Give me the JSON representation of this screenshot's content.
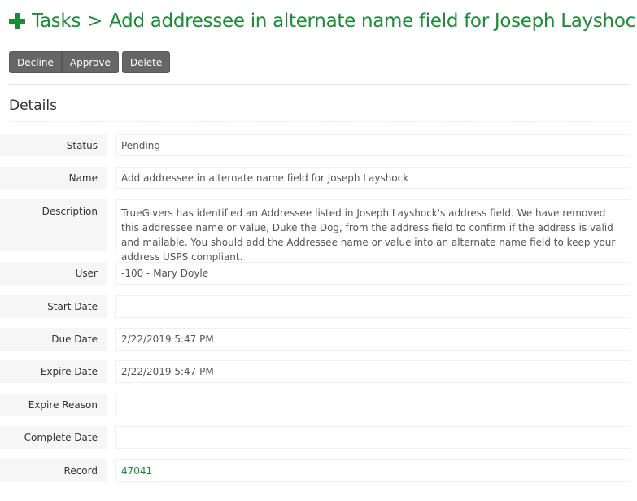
{
  "header": {
    "breadcrumb_root": "Tasks",
    "separator": ">",
    "title": "Add addressee in alternate name field for Joseph Layshock",
    "icon": "plus-icon",
    "accent_color": "#1d8a3a"
  },
  "toolbar": {
    "decline_label": "Decline",
    "approve_label": "Approve",
    "delete_label": "Delete"
  },
  "details": {
    "section_title": "Details",
    "fields": [
      {
        "label": "Status",
        "value": "Pending"
      },
      {
        "label": "Name",
        "value": "Add addressee in alternate name field for Joseph Layshock"
      },
      {
        "label": "Description",
        "value": "TrueGivers has identified an Addressee listed in Joseph Layshock's address field. We have removed this addressee name or value, Duke the Dog, from the address field to confirm if the address is valid and mailable. You should add the Addressee name or value into an alternate name field to keep your address USPS compliant."
      },
      {
        "label": "User",
        "value": "-100 - Mary Doyle"
      },
      {
        "label": "Start Date",
        "value": ""
      },
      {
        "label": "Due Date",
        "value": "2/22/2019 5:47 PM"
      },
      {
        "label": "Expire Date",
        "value": "2/22/2019 5:47 PM"
      },
      {
        "label": "Expire Reason",
        "value": ""
      },
      {
        "label": "Complete Date",
        "value": ""
      },
      {
        "label": "Record",
        "value": "47041"
      }
    ]
  }
}
